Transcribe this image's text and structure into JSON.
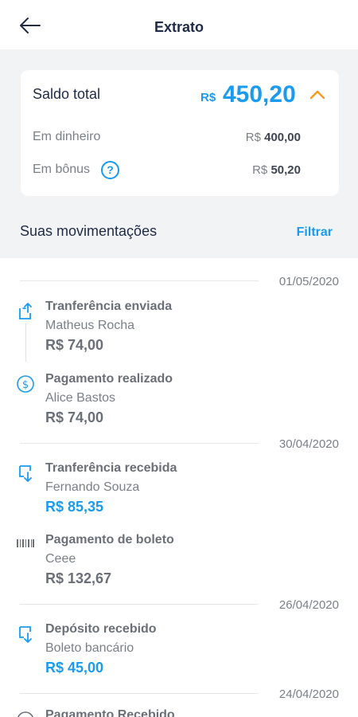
{
  "header": {
    "title": "Extrato",
    "back_icon": "arrow-left-icon"
  },
  "balance": {
    "label": "Saldo total",
    "currency": "R$",
    "value": "450,20",
    "expand_icon": "chevron-up-icon",
    "rows": [
      {
        "label": "Em dinheiro",
        "currency": "R$",
        "value": "400,00"
      },
      {
        "label": "Em bônus",
        "currency": "R$",
        "value": "50,20",
        "help": "?"
      }
    ]
  },
  "movements": {
    "title": "Suas movimentações",
    "filter_label": "Filtrar",
    "groups": [
      {
        "date": "01/05/2020",
        "items": [
          {
            "title": "Tranferência enviada",
            "subtitle": "Matheus Rocha",
            "amount": "R$ 74,00",
            "icon": "transfer-out-icon",
            "color": "#6a6f78"
          },
          {
            "title": "Pagamento realizado",
            "subtitle": "Alice Bastos",
            "amount": "R$ 74,00",
            "icon": "dollar-circle-icon",
            "color": "#6a6f78"
          }
        ]
      },
      {
        "date": "30/04/2020",
        "items": [
          {
            "title": "Tranferência recebida",
            "subtitle": "Fernando Souza",
            "amount": "R$ 85,35",
            "icon": "transfer-in-icon",
            "color": "#1a9bef"
          },
          {
            "title": "Pagamento de boleto",
            "subtitle": "Ceee",
            "amount": "R$ 132,67",
            "icon": "barcode-icon",
            "color": "#6a6f78"
          }
        ]
      },
      {
        "date": "26/04/2020",
        "items": [
          {
            "title": "Depósito recebido",
            "subtitle": "Boleto bancário",
            "amount": "R$ 45,00",
            "icon": "deposit-in-icon",
            "color": "#1a9bef"
          }
        ]
      },
      {
        "date": "24/04/2020",
        "items": [
          {
            "title": "Pagamento Recebido",
            "subtitle": "",
            "amount": "",
            "icon": "dollar-circle-icon",
            "color": "#6a6f78"
          }
        ]
      }
    ]
  },
  "colors": {
    "accent": "#1a9bef",
    "text_dark": "#1f2a44",
    "chevron": "#f59a23"
  }
}
